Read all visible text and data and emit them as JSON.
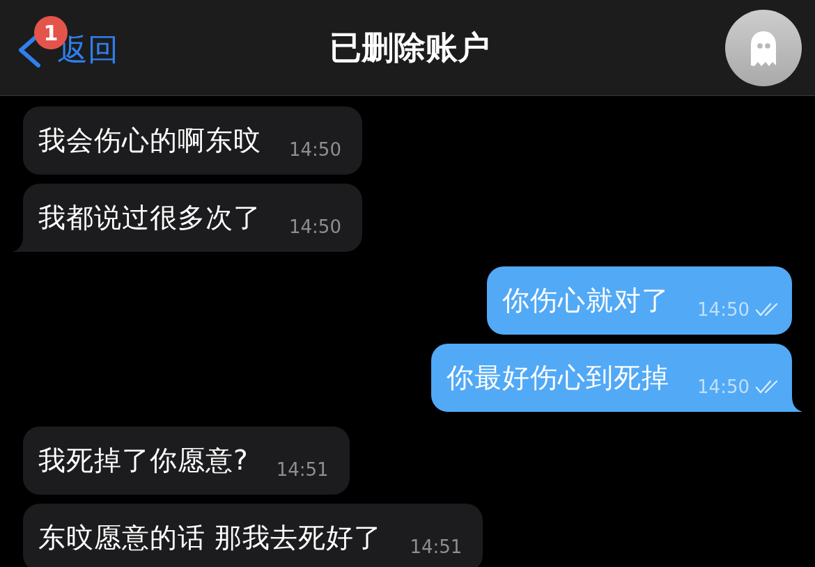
{
  "header": {
    "back_label": "返回",
    "unread_badge": "1",
    "title": "已删除账户"
  },
  "messages": [
    {
      "kind": "incoming",
      "text": "我会伤心的啊东旼",
      "time": "14:50",
      "tail": false
    },
    {
      "kind": "incoming",
      "text": "我都说过很多次了",
      "time": "14:50",
      "tail": true
    },
    {
      "kind": "outgoing",
      "text": "你伤心就对了",
      "time": "14:50",
      "tail": false,
      "read": true
    },
    {
      "kind": "outgoing",
      "text": "你最好伤心到死掉",
      "time": "14:50",
      "tail": true,
      "read": true
    },
    {
      "kind": "incoming",
      "text": "我死掉了你愿意?",
      "time": "14:51",
      "tail": false
    },
    {
      "kind": "incoming",
      "text": "东旼愿意的话 那我去死好了",
      "time": "14:51",
      "tail": false
    }
  ]
}
